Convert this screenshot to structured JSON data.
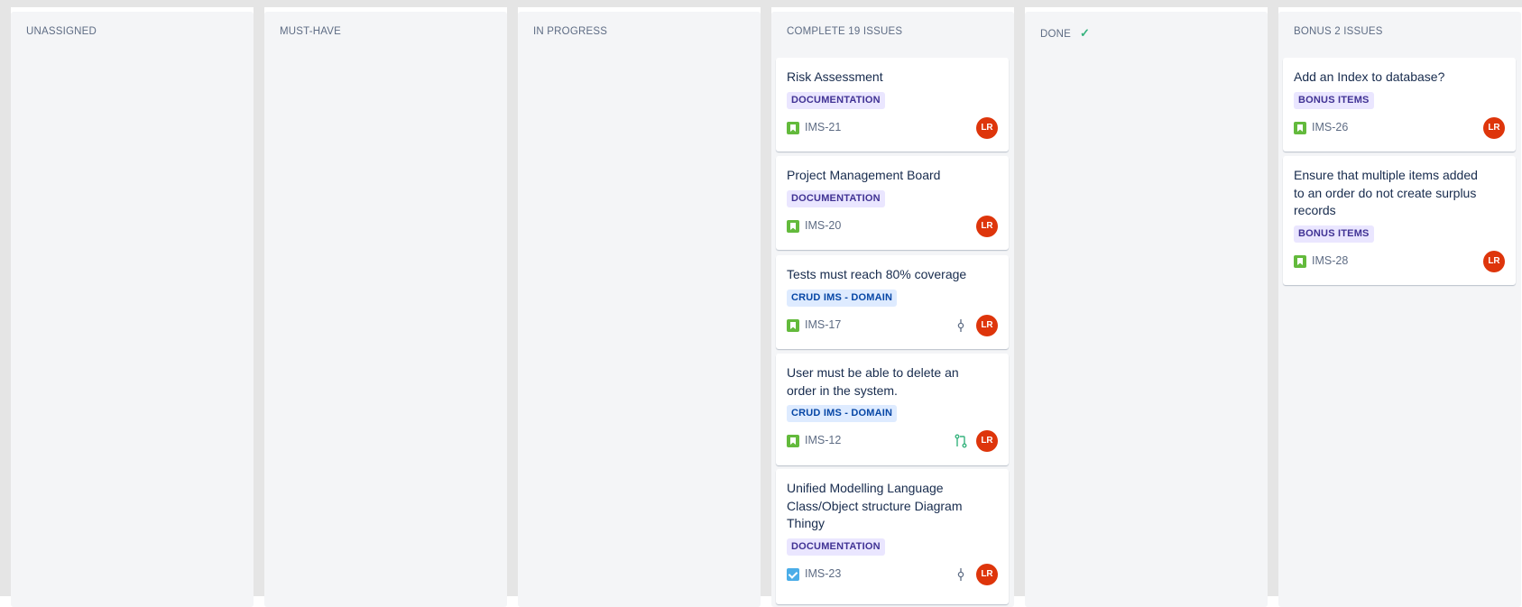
{
  "columns": [
    {
      "title": "UNASSIGNED"
    },
    {
      "title": "MUST-HAVE"
    },
    {
      "title": "IN PROGRESS"
    },
    {
      "title": "COMPLETE 19 ISSUES"
    },
    {
      "title": "DONE"
    },
    {
      "title": "BONUS 2 ISSUES"
    }
  ],
  "cards": {
    "complete": [
      {
        "title": "Risk Assessment",
        "label": "DOCUMENTATION",
        "key": "IMS-21",
        "type": "story",
        "avatar": "LR"
      },
      {
        "title": "Project Management Board",
        "label": "DOCUMENTATION",
        "key": "IMS-20",
        "type": "story",
        "avatar": "LR"
      },
      {
        "title": "Tests must reach 80% coverage",
        "label": "CRUD IMS - DOMAIN",
        "key": "IMS-17",
        "type": "story",
        "avatar": "LR",
        "meta_icon": "commit-icon"
      },
      {
        "title": "User must be able to delete an order in the system.",
        "label": "CRUD IMS - DOMAIN",
        "key": "IMS-12",
        "type": "story",
        "avatar": "LR",
        "meta_icon": "pull-request-icon"
      },
      {
        "title": "Unified Modelling Language Class/Object structure Diagram Thingy",
        "label": "DOCUMENTATION",
        "key": "IMS-23",
        "type": "task",
        "avatar": "LR",
        "meta_icon": "commit-icon"
      }
    ],
    "bonus": [
      {
        "title": "Add an Index to database?",
        "label": "BONUS ITEMS",
        "key": "IMS-26",
        "type": "story",
        "avatar": "LR"
      },
      {
        "title": "Ensure that multiple items added to an order do not create surplus records",
        "label": "BONUS ITEMS",
        "key": "IMS-28",
        "type": "story",
        "avatar": "LR"
      }
    ]
  },
  "colors": {
    "story": "#63ba3c",
    "task": "#4bade8",
    "avatar": "#de350b",
    "column_bg": "#f4f5f7",
    "done_check": "#36b37e"
  }
}
